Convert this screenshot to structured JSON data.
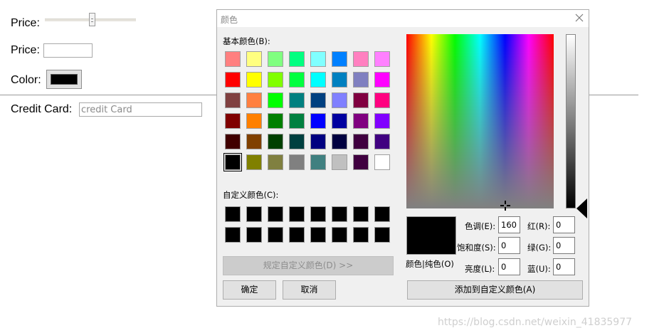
{
  "form": {
    "price_label_1": "Price:",
    "slider_value": 0.5,
    "price_label_2": "Price:",
    "price_value": "",
    "color_label": "Color:",
    "color_value": "#000000",
    "credit_card_label": "Credit Card:",
    "credit_card_placeholder": "credit Card"
  },
  "dialog": {
    "title": "颜色",
    "close_icon": "close-icon",
    "basic_colors_label": "基本颜色(B):",
    "basic_colors": [
      "#ff8080",
      "#ffff80",
      "#80ff80",
      "#00ff80",
      "#80ffff",
      "#0080ff",
      "#ff80c0",
      "#ff80ff",
      "#ff0000",
      "#ffff00",
      "#80ff00",
      "#00ff40",
      "#00ffff",
      "#0080c0",
      "#8080c0",
      "#ff00ff",
      "#804040",
      "#ff8040",
      "#00ff00",
      "#008080",
      "#004080",
      "#8080ff",
      "#800040",
      "#ff0080",
      "#800000",
      "#ff8000",
      "#008000",
      "#008040",
      "#0000ff",
      "#0000a0",
      "#800080",
      "#8000ff",
      "#400000",
      "#804000",
      "#004000",
      "#004040",
      "#000080",
      "#000040",
      "#400040",
      "#400080",
      "#000000",
      "#808000",
      "#808040",
      "#808080",
      "#408080",
      "#c0c0c0",
      "#400040",
      "#ffffff"
    ],
    "selected_basic_index": 40,
    "custom_colors_label": "自定义颜色(C):",
    "custom_colors": [
      "#000000",
      "#000000",
      "#000000",
      "#000000",
      "#000000",
      "#000000",
      "#000000",
      "#000000",
      "#000000",
      "#000000",
      "#000000",
      "#000000",
      "#000000",
      "#000000",
      "#000000",
      "#000000"
    ],
    "define_custom_button": "规定自定义颜色(D) >>",
    "ok_button": "确定",
    "cancel_button": "取消",
    "preview_label": "颜色|纯色(O)",
    "hue_label": "色调(E):",
    "hue_value": "160",
    "sat_label": "饱和度(S):",
    "sat_value": "0",
    "lum_label": "亮度(L):",
    "lum_value": "0",
    "red_label": "红(R):",
    "red_value": "0",
    "green_label": "绿(G):",
    "green_value": "0",
    "blue_label": "蓝(U):",
    "blue_value": "0",
    "add_custom_button": "添加到自定义颜色(A)"
  },
  "watermark": "https://blog.csdn.net/weixin_41835977"
}
